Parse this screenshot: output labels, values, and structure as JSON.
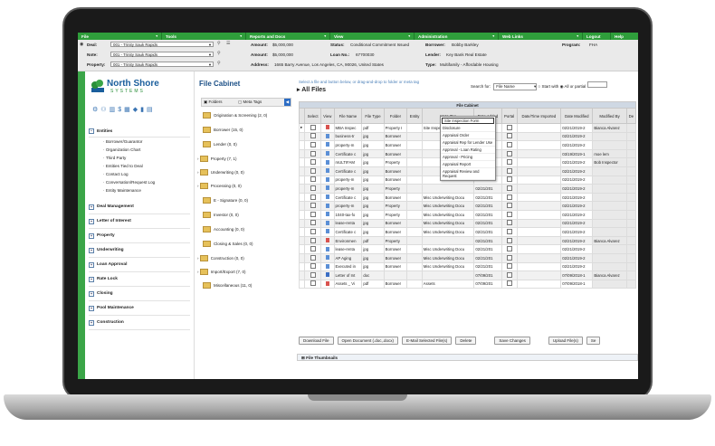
{
  "menu": [
    {
      "label": "File"
    },
    {
      "label": "Tools"
    },
    {
      "label": "Reports and Docs"
    },
    {
      "label": "View"
    },
    {
      "label": "Administration"
    },
    {
      "label": "Web Links"
    },
    {
      "label": "Logout"
    },
    {
      "label": "Help"
    }
  ],
  "info": {
    "deal_label": "Deal:",
    "deal_value": "001 - Trinity Sauk Rapids",
    "note_label": "Note:",
    "note_value": "001 - Trinity Sauk Rapids",
    "property_label": "Property:",
    "property_value": "001 - Trinity Sauk Rapids",
    "amount1_label": "Amount:",
    "amount1_value": "$5,000,000",
    "amount2_label": "Amount:",
    "amount2_value": "$5,000,000",
    "address_label": "Address:",
    "address_value": "1665 Barry Avenue, Los Angeles, CA, 90026, United States",
    "status_label": "Status:",
    "status_value": "Conditional Commitment Issued",
    "loanno_label": "Loan No.:",
    "loanno_value": "67700030",
    "borrower_label": "Borrower:",
    "borrower_value": "Bobby Barkley",
    "lender_label": "Lender:",
    "lender_value": "Key Bank Real Estate",
    "type_label": "Type:",
    "type_value": "Multifamily - Affordable Housing",
    "program_label": "Program:",
    "program_value": "FHA"
  },
  "logo": {
    "name": "North Shore",
    "sub": "SYSTEMS"
  },
  "nav": {
    "entities": "Entities",
    "entity_items": [
      "Borrower/Guarantor",
      "Organization Chart",
      "Third Party",
      "Entities Tied to Deal",
      "Contact Log",
      "Conversation/Request Log",
      "Entity Maintenance"
    ],
    "sections": [
      "Deal Management",
      "Letter of Interest",
      "Property",
      "Underwriting",
      "Loan Approval",
      "Rate Lock",
      "Closing",
      "Pool Maintenance",
      "Construction"
    ]
  },
  "cabinet": {
    "title": "File Cabinet",
    "tab_folders": "Folders",
    "tab_meta": "Meta Tags",
    "folders": [
      "Origination & Screening (2, 0)",
      "Borrower (15, 0)",
      "Lender (0, 0)",
      "Property (7, 1)",
      "Underwriting (0, 0)",
      "Processing (0, 0)",
      "E - Signature (0, 0)",
      "Investor (0, 0)",
      "Accounting (0, 0)",
      "Closing & Sales (0, 0)",
      "Construction (0, 0)",
      "Import/Export (7, 0)",
      "Miscellaneous (11, 0)"
    ]
  },
  "files": {
    "hint": "Select a file and button below, or drag-and-drop to folder or meta tag",
    "title": "All Files",
    "search_label": "Search for:",
    "search_value": "File Name",
    "opt_start": "Start with",
    "opt_any": "All or partial",
    "caption": "File Cabinet",
    "columns": [
      "",
      "Select",
      "View",
      "File Name",
      "File Type",
      "Folder",
      "Entity",
      "Meta Tag",
      "Date Added",
      "Portal",
      "Date/Time Imported",
      "Date Modified",
      "Modified By",
      "De"
    ],
    "rows": [
      {
        "name": "MBA Inspec",
        "type": "pdf",
        "folder": "Property I",
        "meta": "Site Inspection Form",
        "date": "02/21/201",
        "mod": "02/21/2019-2",
        "by": "Bianca Alvarez",
        "icon": "pdf"
      },
      {
        "name": "business-tr",
        "type": "jpg",
        "folder": "Borrower",
        "meta": "",
        "date": "02/21/201",
        "mod": "02/21/2019-2",
        "by": "",
        "icon": "img"
      },
      {
        "name": "property-m",
        "type": "jpg",
        "folder": "Borrower",
        "meta": "",
        "date": "02/21/201",
        "mod": "02/21/2019-2",
        "by": "",
        "icon": "img"
      },
      {
        "name": "Certificate c",
        "type": "jpg",
        "folder": "Borrower",
        "meta": "",
        "date": "02/21/201",
        "mod": "03/19/2019-1",
        "by": "moe lem",
        "icon": "img"
      },
      {
        "name": "mULTIFAM",
        "type": "jpg",
        "folder": "Property",
        "meta": "",
        "date": "02/21/201",
        "mod": "02/21/2019-2",
        "by": "Bob Inspector",
        "icon": "img"
      },
      {
        "name": "Certificate c",
        "type": "jpg",
        "folder": "Borrower",
        "meta": "",
        "date": "02/21/201",
        "mod": "02/21/2019-2",
        "by": "",
        "icon": "img"
      },
      {
        "name": "property-m",
        "type": "jpg",
        "folder": "Borrower",
        "meta": "",
        "date": "02/21/201",
        "mod": "02/21/2019-2",
        "by": "",
        "icon": "img"
      },
      {
        "name": "property-m",
        "type": "jpg",
        "folder": "Property",
        "meta": "",
        "date": "02/21/201",
        "mod": "02/21/2019-2",
        "by": "",
        "icon": "img"
      },
      {
        "name": "Certificate c",
        "type": "jpg",
        "folder": "Borrower",
        "meta": "Misc Underwriting Docu",
        "date": "02/21/201",
        "mod": "02/21/2019-2",
        "by": "",
        "icon": "img"
      },
      {
        "name": "property-m",
        "type": "jpg",
        "folder": "Property",
        "meta": "Misc Underwriting Docu",
        "date": "02/21/201",
        "mod": "02/21/2019-2",
        "by": "",
        "icon": "img"
      },
      {
        "name": "1040-tax-fo",
        "type": "jpg",
        "folder": "Property",
        "meta": "Misc Underwriting Docu",
        "date": "02/21/201",
        "mod": "02/21/2019-2",
        "by": "",
        "icon": "img"
      },
      {
        "name": "lease-renta",
        "type": "jpg",
        "folder": "Borrower",
        "meta": "Misc Underwriting Docu",
        "date": "02/21/201",
        "mod": "02/21/2019-2",
        "by": "",
        "icon": "img"
      },
      {
        "name": "Certificate c",
        "type": "jpg",
        "folder": "Borrower",
        "meta": "Misc Underwriting Docu",
        "date": "02/21/201",
        "mod": "02/21/2019-2",
        "by": "",
        "icon": "img"
      },
      {
        "name": "Environmen",
        "type": "pdf",
        "folder": "Property",
        "meta": "",
        "date": "02/21/201",
        "mod": "02/21/2019-2",
        "by": "Bianca Alvarez",
        "icon": "pdf"
      },
      {
        "name": "lease-renta",
        "type": "jpg",
        "folder": "Borrower",
        "meta": "Misc Underwriting Docu",
        "date": "02/21/201",
        "mod": "02/21/2019-2",
        "by": "",
        "icon": "img"
      },
      {
        "name": "AP Aging",
        "type": "jpg",
        "folder": "Borrower",
        "meta": "Misc Underwriting Docu",
        "date": "02/21/201",
        "mod": "02/21/2019-2",
        "by": "",
        "icon": "img"
      },
      {
        "name": "Executed in",
        "type": "jpg",
        "folder": "Borrower",
        "meta": "Misc Underwriting Docu",
        "date": "02/21/201",
        "mod": "02/21/2019-2",
        "by": "",
        "icon": "img"
      },
      {
        "name": "Letter of Int",
        "type": "doc",
        "folder": "",
        "meta": "",
        "date": "07/09/201",
        "mod": "07/09/2018-1",
        "by": "Bianca Alvarez",
        "icon": "doc"
      },
      {
        "name": "Assets _ Vi",
        "type": "pdf",
        "folder": "Borrower",
        "meta": "Assets",
        "date": "07/09/201",
        "mod": "07/09/2018-1",
        "by": "",
        "icon": "pdf"
      }
    ],
    "dropdown": [
      "Site Inspection Form",
      "Disclosure",
      "Appraisal Order",
      "Appraisal Rep for Lender Use",
      "Approval - Loan Rating",
      "Approval - Pricing",
      "Appraisal Report",
      "Appraisal Review and Request"
    ],
    "buttons": [
      "Download File",
      "Open Document (.doc,.docx)",
      "E-Mail Selected File(s)",
      "Delete",
      "Save Changes",
      "Upload File(s)",
      "Se"
    ],
    "thumbnails": "File Thumbnails"
  }
}
